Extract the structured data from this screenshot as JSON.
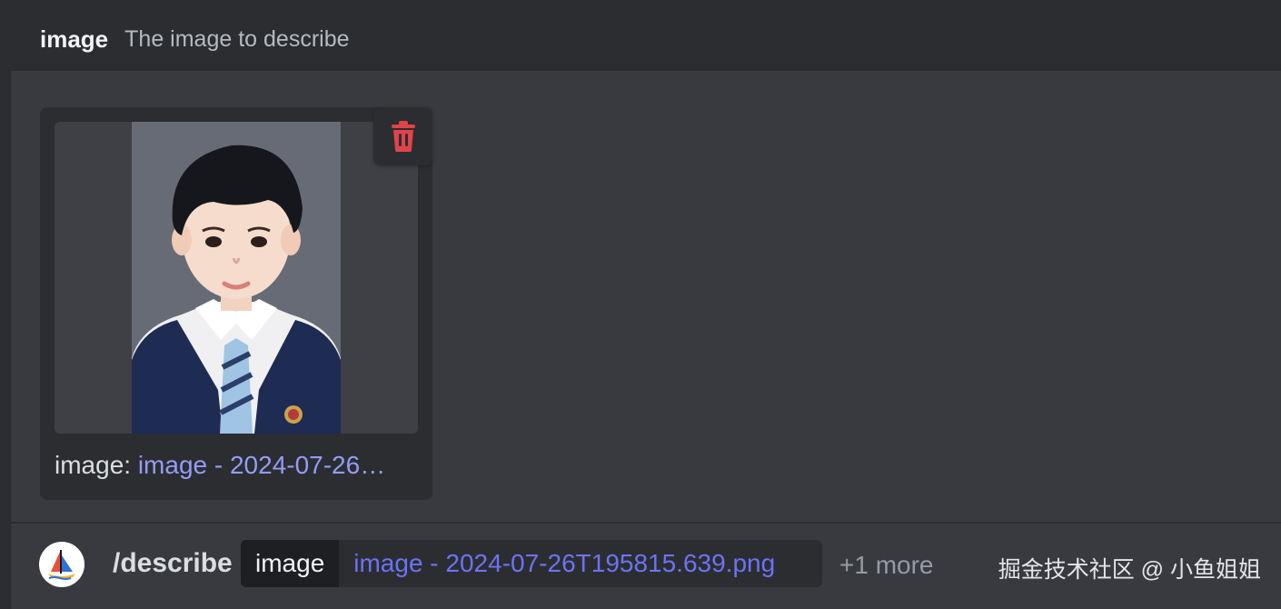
{
  "option_header": {
    "name": "image",
    "description": "The image to describe"
  },
  "attachment": {
    "label_prefix": "image:",
    "file_link": "image - 2024-07-26…",
    "delete_icon": "trash-icon"
  },
  "command": {
    "bot_icon": "midjourney-boat-icon",
    "name": "/describe",
    "option_key": "image",
    "option_value": "image - 2024-07-26T195815.639.png",
    "more": "+1 more"
  },
  "watermark": "掘金技术社区 @ 小鱼姐姐",
  "colors": {
    "background": "#383a40",
    "header": "#2b2d31",
    "link": "#949cf7",
    "pill_link": "#6c73f3",
    "danger": "#e0434a"
  }
}
